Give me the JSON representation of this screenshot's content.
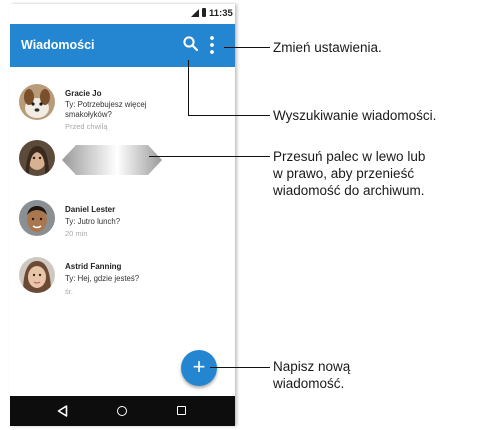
{
  "status_bar": {
    "time": "11:35"
  },
  "app_bar": {
    "title": "Wiadomości"
  },
  "conversations": [
    {
      "name": "Gracie Jo",
      "message_line1": "Ty: Potrzebujesz więcej",
      "message_line2": "smakołyków?",
      "time": "Przed chwilą"
    },
    {
      "name": "Daniel Lester",
      "message_line1": "Ty: Jutro lunch?",
      "time": "20 min"
    },
    {
      "name": "Astrid Fanning",
      "message_line1": "Ty: Hej, gdzie jesteś?",
      "time": "śr."
    }
  ],
  "fab": {
    "symbol": "+"
  },
  "callouts": {
    "settings": "Zmień ustawienia.",
    "search": "Wyszukiwanie wiadomości.",
    "swipe_line1": "Przesuń palec w lewo lub",
    "swipe_line2": "w prawo, aby przenieść",
    "swipe_line3": "wiadomość do archiwum.",
    "compose_line1": "Napisz nową",
    "compose_line2": "wiadomość."
  },
  "colors": {
    "accent": "#2486d1",
    "nav_bar": "#0d0d0d"
  }
}
